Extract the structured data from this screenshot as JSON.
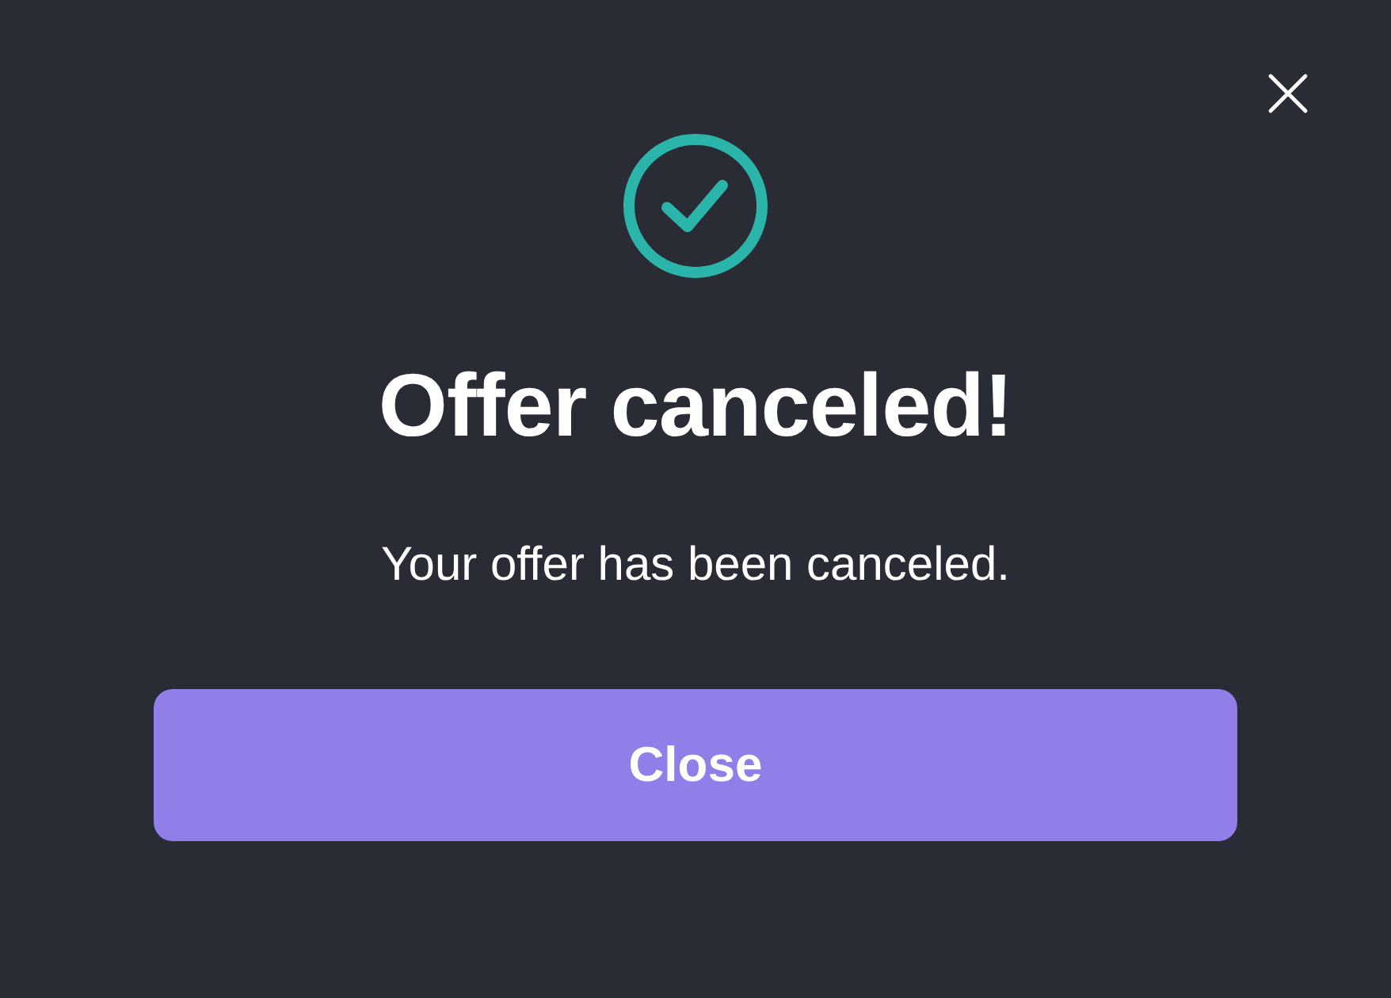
{
  "dialog": {
    "title": "Offer canceled!",
    "message": "Your offer has been canceled.",
    "button": "Close"
  }
}
